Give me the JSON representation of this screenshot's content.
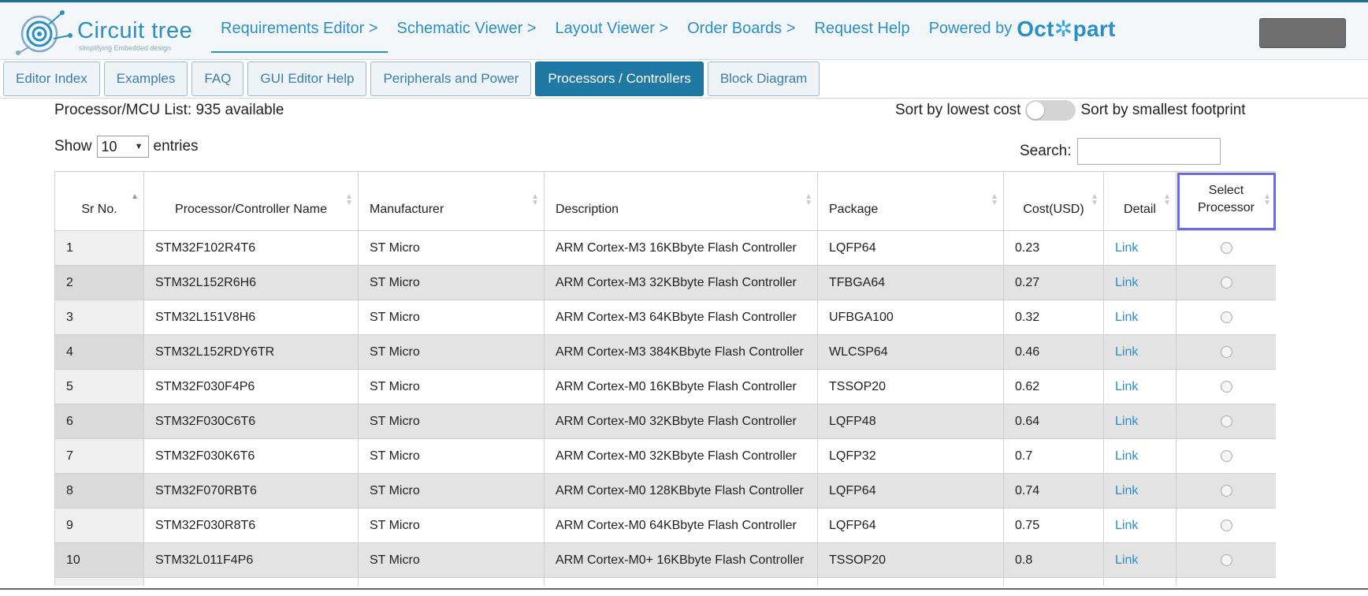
{
  "brand": {
    "name": "Circuit tree",
    "tagline": "simplifying Embedded design"
  },
  "nav": {
    "items": [
      {
        "label": "Requirements Editor >",
        "active": true
      },
      {
        "label": "Schematic Viewer >",
        "active": false
      },
      {
        "label": "Layout Viewer >",
        "active": false
      },
      {
        "label": "Order Boards >",
        "active": false
      },
      {
        "label": "Request Help",
        "active": false
      }
    ],
    "powered_by": "Powered by",
    "octopart_pre": "Oct",
    "octopart_gear": "✲",
    "octopart_post": "part"
  },
  "tabs": [
    {
      "label": "Editor Index",
      "active": false
    },
    {
      "label": "Examples",
      "active": false
    },
    {
      "label": "FAQ",
      "active": false
    },
    {
      "label": "GUI Editor Help",
      "active": false
    },
    {
      "label": "Peripherals and Power",
      "active": false
    },
    {
      "label": "Processors / Controllers",
      "active": true
    },
    {
      "label": "Block Diagram",
      "active": false
    }
  ],
  "list": {
    "title": "Processor/MCU List: 935 available",
    "sort_left": "Sort by lowest cost",
    "sort_right": "Sort by smallest footprint",
    "show_prefix": "Show",
    "entries_value": "10",
    "show_suffix": "entries",
    "search_label": "Search:",
    "search_value": ""
  },
  "table": {
    "headers": [
      "Sr No.",
      "Processor/Controller Name",
      "Manufacturer",
      "Description",
      "Package",
      "Cost(USD)",
      "Detail",
      "Select Processor"
    ],
    "link_label": "Link",
    "rows": [
      [
        "1",
        "STM32F102R4T6",
        "ST Micro",
        "ARM Cortex-M3 16KBbyte Flash Controller",
        "LQFP64",
        "0.23"
      ],
      [
        "2",
        "STM32L152R6H6",
        "ST Micro",
        "ARM Cortex-M3 32KBbyte Flash Controller",
        "TFBGA64",
        "0.27"
      ],
      [
        "3",
        "STM32L151V8H6",
        "ST Micro",
        "ARM Cortex-M3 64KBbyte Flash Controller",
        "UFBGA100",
        "0.32"
      ],
      [
        "4",
        "STM32L152RDY6TR",
        "ST Micro",
        "ARM Cortex-M3 384KBbyte Flash Controller",
        "WLCSP64",
        "0.46"
      ],
      [
        "5",
        "STM32F030F4P6",
        "ST Micro",
        "ARM Cortex-M0 16KBbyte Flash Controller",
        "TSSOP20",
        "0.62"
      ],
      [
        "6",
        "STM32F030C6T6",
        "ST Micro",
        "ARM Cortex-M0 32KBbyte Flash Controller",
        "LQFP48",
        "0.64"
      ],
      [
        "7",
        "STM32F030K6T6",
        "ST Micro",
        "ARM Cortex-M0 32KBbyte Flash Controller",
        "LQFP32",
        "0.7"
      ],
      [
        "8",
        "STM32F070RBT6",
        "ST Micro",
        "ARM Cortex-M0 128KBbyte Flash Controller",
        "LQFP64",
        "0.74"
      ],
      [
        "9",
        "STM32F030R8T6",
        "ST Micro",
        "ARM Cortex-M0 64KBbyte Flash Controller",
        "LQFP64",
        "0.75"
      ],
      [
        "10",
        "STM32L011F4P6",
        "ST Micro",
        "ARM Cortex-M0+ 16KBbyte Flash Controller",
        "TSSOP20",
        "0.8"
      ]
    ]
  },
  "colors": {
    "accent": "#2a8fc2",
    "active_tab": "#1f79a4",
    "selected_outline": "#6b6be0"
  }
}
